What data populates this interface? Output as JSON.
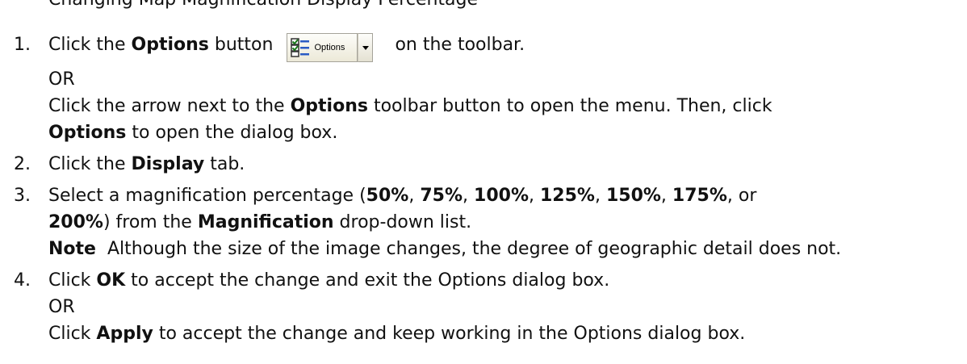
{
  "top_fragment": "Changing Map Magnification Display Percentage",
  "toolbar_button": {
    "label": "Options"
  },
  "steps": [
    {
      "num": "1.",
      "a": "Click the ",
      "b": "Options",
      "c": " button ",
      "d": " on the toolbar.",
      "or": "OR",
      "e": "Click the arrow next to the ",
      "f": "Options",
      "g": " toolbar button to open the menu. Then, click ",
      "h": "Options",
      "i": " to open the dialog box."
    },
    {
      "num": "2.",
      "a": "Click the ",
      "b": "Display",
      "c": " tab."
    },
    {
      "num": "3.",
      "a": "Select a magnification percentage (",
      "p1": "50%",
      "s1": ", ",
      "p2": "75%",
      "s2": ", ",
      "p3": "100%",
      "s3": ", ",
      "p4": "125%",
      "s4": ", ",
      "p5": "150%",
      "s5": ", ",
      "p6": "175%",
      "s6": ", or",
      "p7": "200%",
      "b": ") from the ",
      "c": "Magnification",
      "d": " drop-down list.",
      "note_label": "Note",
      "note_text": "  Although the size of the image changes, the degree of geographic detail does not."
    },
    {
      "num": "4.",
      "a": "Click ",
      "b": "OK",
      "c": " to accept the change and exit the Options dialog box.",
      "or": "OR",
      "d": "Click ",
      "e": "Apply",
      "f": " to accept the change and keep working in the Options dialog box."
    }
  ]
}
